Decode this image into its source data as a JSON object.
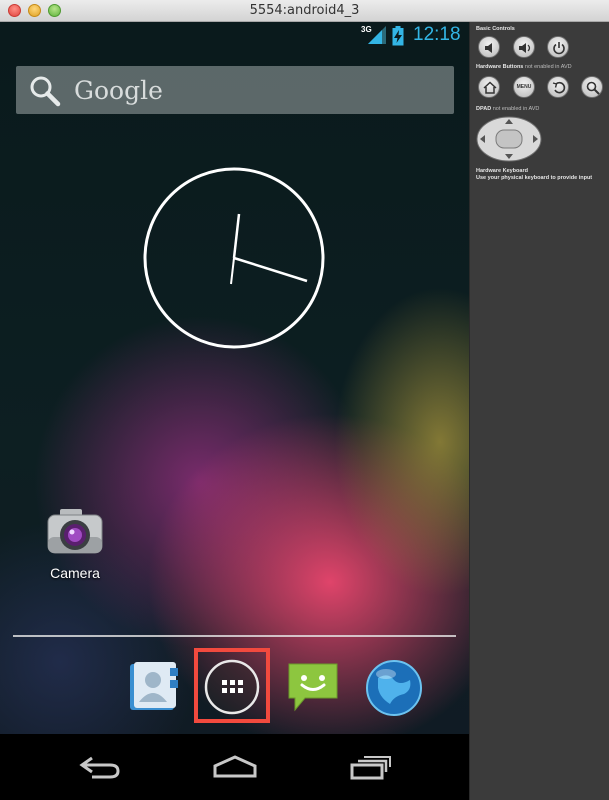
{
  "window": {
    "title": "5554:android4_3"
  },
  "statusbar": {
    "network": "3G",
    "time": "12:18"
  },
  "search": {
    "label": "Google"
  },
  "home": {
    "apps": [
      {
        "label": "Camera"
      }
    ]
  },
  "panel": {
    "basic_controls": "Basic Controls",
    "hardware_buttons": "Hardware Buttons",
    "hardware_buttons_note": "not enabled in AVD",
    "menu_label": "MENU",
    "dpad": "DPAD",
    "dpad_note": "not enabled in AVD",
    "keyboard_title": "Hardware Keyboard",
    "keyboard_note": "Use your physical keyboard to provide input"
  },
  "colors": {
    "clock_accent": "#33b5e5",
    "highlight": "#f24a3e"
  }
}
